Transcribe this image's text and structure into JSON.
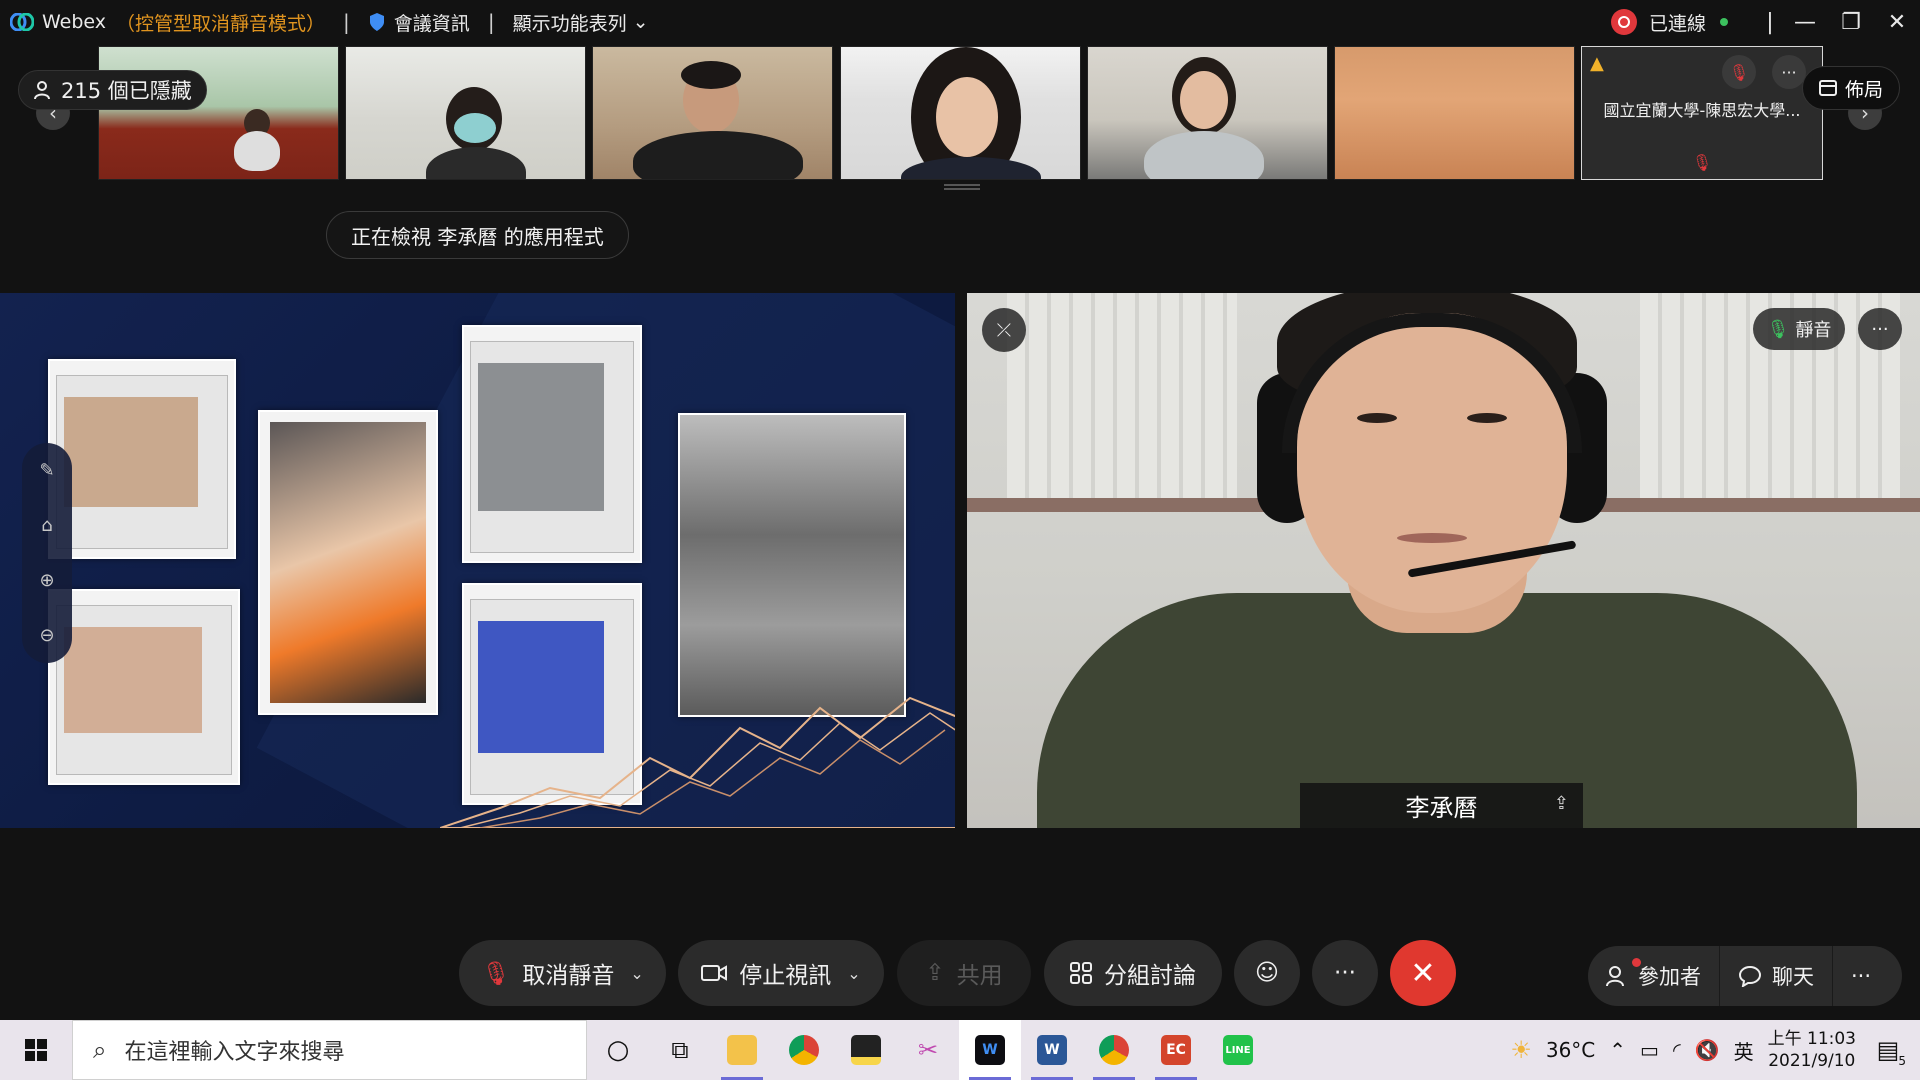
{
  "titlebar": {
    "app_name": "Webex",
    "mode": "（控管型取消靜音模式）",
    "separator": "|",
    "meeting_info": "會議資訊",
    "show_menu": "顯示功能表列",
    "connected": "已連線",
    "window_controls": {
      "minimize": "—",
      "restore": "❐",
      "close": "✕"
    }
  },
  "filmstrip": {
    "hidden_count": "215 個已隱藏",
    "participant_tile": {
      "name": "國立宜蘭大學-陳思宏大學...",
      "warning": "▲"
    },
    "layout_button": "佈局"
  },
  "viewing_banner": "正在檢視 李承曆 的應用程式",
  "active_speaker": {
    "name": "李承曆",
    "mute_button": "靜音"
  },
  "controls": {
    "unmute": "取消靜音",
    "stop_video": "停止視訊",
    "share": "共用",
    "breakout": "分組討論",
    "participants": "參加者",
    "chat": "聊天",
    "more": "···",
    "end": "✕"
  },
  "taskbar": {
    "search_placeholder": "在這裡輸入文字來搜尋",
    "weather": "36°C",
    "ime": "英",
    "time": "上午 11:03",
    "date": "2021/9/10",
    "notifications": "5"
  },
  "colors": {
    "accent_orange": "#e0941f",
    "end_red": "#e0382f",
    "connected_green": "#3cc15e"
  }
}
